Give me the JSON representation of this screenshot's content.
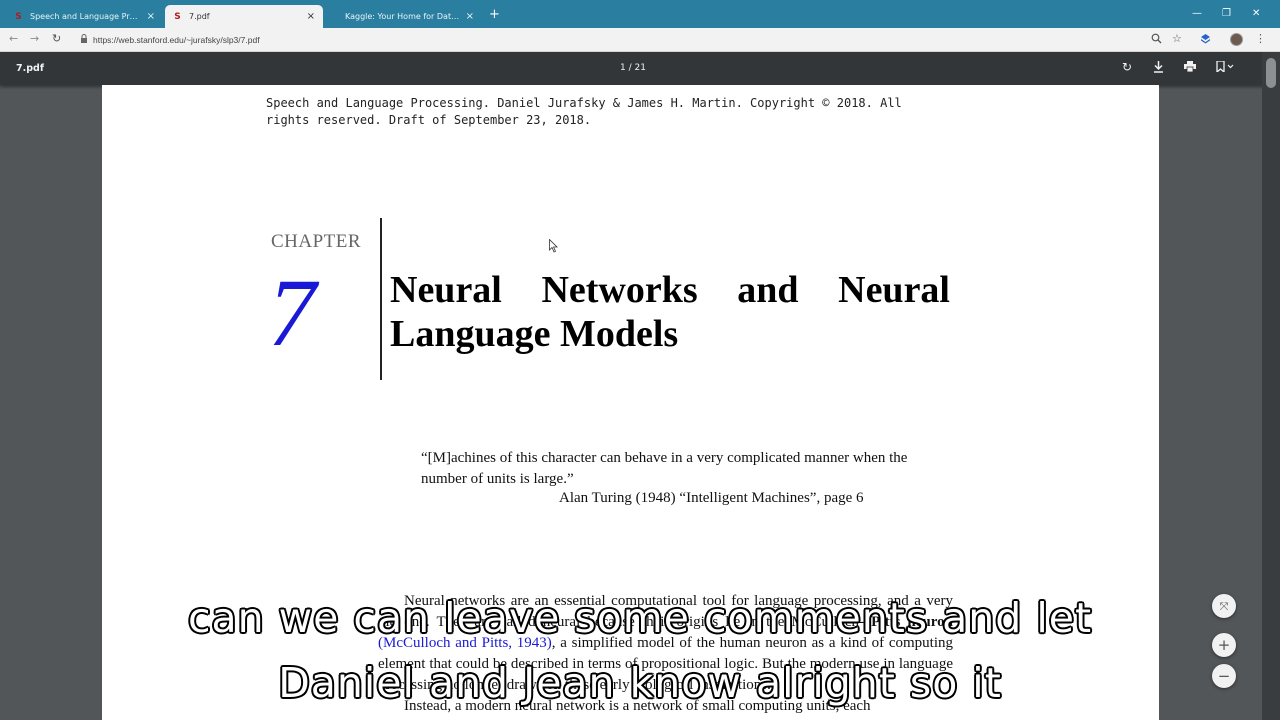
{
  "browser": {
    "tabs": [
      {
        "favicon": "stanford-s-icon",
        "title": "Speech and Language Processin",
        "close": "×",
        "active": false
      },
      {
        "favicon": "stanford-s-icon",
        "title": "7.pdf",
        "close": "×",
        "active": true
      },
      {
        "favicon": "kaggle-icon",
        "title": "Kaggle: Your Home for Data Scie",
        "close": "×",
        "active": false
      }
    ],
    "new_tab": "+",
    "window_controls": {
      "minimize": "—",
      "restore": "❐",
      "close": "✕"
    },
    "nav": {
      "back": "←",
      "forward": "→",
      "reload": "↻"
    },
    "url": "https://web.stanford.edu/~jurafsky/slp3/7.pdf",
    "toolbar_icons": [
      "zoom-icon",
      "star-icon",
      "extension-icon",
      "profile-avatar",
      "menu-icon"
    ],
    "accent_color": "#2a7fa0"
  },
  "pdf_viewer": {
    "title": "7.pdf",
    "page_indicator": "1 / 21",
    "buttons": {
      "rotate": "↻",
      "download": "⤓",
      "print": "⎙",
      "bookmark": "▯▾"
    },
    "zoom": {
      "fit": "⤧",
      "in": "+",
      "out": "−"
    }
  },
  "page": {
    "running_head": "Speech and Language Processing.  Daniel Jurafsky & James H. Martin.  Copyright © 2018.  All\nrights reserved.  Draft of September 23, 2018.",
    "chapter_label": "CHAPTER",
    "chapter_number": "7",
    "chapter_title": "Neural Networks and Neural Language Models",
    "epigraph": "“[M]achines of this character can behave in a very complicated manner when the number of units is large.”",
    "epigraph_source": "Alan Turing (1948) “Intelligent Machines”, page 6",
    "body": {
      "line1": "Neural networks are an essential computational tool for language processing, and a very old one. They are called neural because their origins lie in the McCulloch-",
      "term": "Pitts neuron",
      "citation": "(McCulloch and Pitts, 1943)",
      "line3": ", a simplified model of the human neuron as a kind of computing element that could be described in terms of propositional logic. But the modern use in language processing no longer draws on these early biological inspirations.",
      "line4": "Instead, a modern neural network is a network of small computing units, each"
    }
  },
  "captions": {
    "line1": "can we can leave some comments and let",
    "line2": "Daniel and Jean know alright so it"
  }
}
